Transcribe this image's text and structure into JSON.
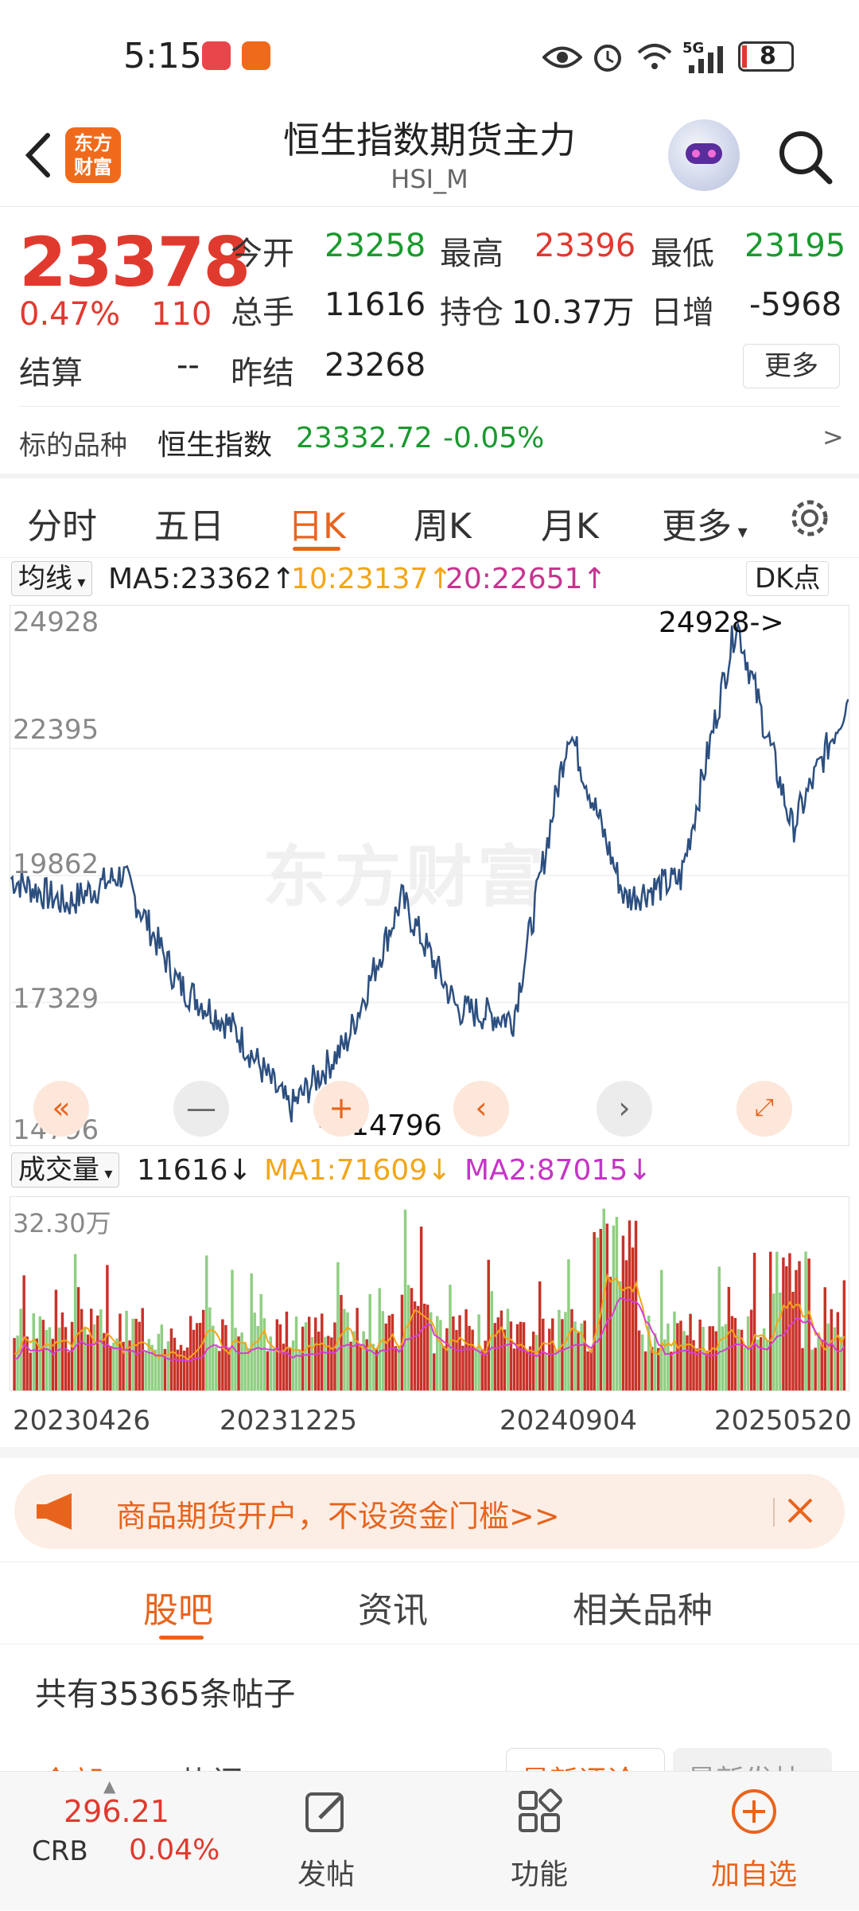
{
  "status_bar": {
    "time": "5:15",
    "battery": "8",
    "network": "5G"
  },
  "header": {
    "back_icon": "chevron-left-icon",
    "logo_line1": "东方",
    "logo_line2": "财富",
    "title": "恒生指数期货主力",
    "subtitle": "HSI_M"
  },
  "quote": {
    "price": "23378",
    "change_pct": "0.47%",
    "change": "110",
    "open_label": "今开",
    "open": "23258",
    "high_label": "最高",
    "high": "23396",
    "low_label": "最低",
    "low": "23195",
    "volume_label": "总手",
    "volume": "11616",
    "oi_label": "持仓",
    "oi": "10.37万",
    "daily_inc_label": "日增",
    "daily_inc": "-5968",
    "settle_label": "结算",
    "settle": "--",
    "prev_settle_label": "昨结",
    "prev_settle": "23268",
    "more_label": "更多",
    "underlying_label": "标的品种",
    "underlying_name": "恒生指数",
    "underlying_value": "23332.72",
    "underlying_pct": "-0.05%",
    "underlying_arrow": ">"
  },
  "chart_tabs": {
    "items": [
      "分时",
      "五日",
      "日K",
      "周K",
      "月K",
      "更多"
    ],
    "active": "日K"
  },
  "ma_row": {
    "selector": "均线",
    "ma5": "MA5:23362↑",
    "ma10": "10:23137↑",
    "ma20": "20:22651↑",
    "dk": "DK点"
  },
  "price_chart": {
    "y_labels": [
      "24928",
      "22395",
      "19862",
      "17329",
      "14796"
    ],
    "max_marker": "24928->",
    "min_marker": "<-14796",
    "watermark": "东方财富",
    "colors": {
      "line": "#2c4f80",
      "up": "#c83228",
      "down": "#8fcf82",
      "ma1": "#f2a618",
      "ma2": "#d43fd0"
    }
  },
  "volume_row": {
    "selector": "成交量",
    "value": "11616↓",
    "ma1": "MA1:71609↓",
    "ma2": "MA2:87015↓",
    "max_label": "32.30万"
  },
  "dates": [
    "20230426",
    "20231225",
    "20240904",
    "20250520"
  ],
  "ad": {
    "text": "商品期货开户，不设资金门槛>>"
  },
  "bottom_tabs": {
    "items": [
      "股吧",
      "资讯",
      "相关品种"
    ],
    "active": "股吧"
  },
  "posts": {
    "count_text": "共有35365条帖子",
    "sub_tabs": [
      "全部",
      "热门",
      "最新评论",
      "最新发帖"
    ]
  },
  "nav": {
    "index_value": "296.21",
    "index_name": "CRB",
    "index_pct": "0.04%",
    "post_label": "发帖",
    "func_label": "功能",
    "add_label": "加自选"
  },
  "chart_data": [
    {
      "type": "line",
      "xlabel": "",
      "ylabel": "",
      "x": [
        "20230426",
        "20230601",
        "20230801",
        "20231001",
        "20231225",
        "20240122",
        "20240301",
        "20240515",
        "20240701",
        "20240904",
        "20241008",
        "20241201",
        "20250201",
        "20250320",
        "20250409",
        "20250520"
      ],
      "values": [
        19800,
        19300,
        19900,
        17700,
        16800,
        15200,
        16500,
        19400,
        17200,
        17000,
        22800,
        19400,
        19800,
        24928,
        20800,
        23378
      ],
      "ylim": [
        14796,
        24928
      ],
      "annotations": [
        "24928->",
        "<-14796"
      ]
    },
    {
      "type": "bar",
      "title": "成交量",
      "x": [
        "20230426",
        "20231225",
        "20240904",
        "20250520"
      ],
      "series": [
        {
          "name": "MA1",
          "values": [
            71609
          ]
        },
        {
          "name": "MA2",
          "values": [
            87015
          ]
        }
      ],
      "ylim": [
        0,
        323000
      ]
    }
  ]
}
